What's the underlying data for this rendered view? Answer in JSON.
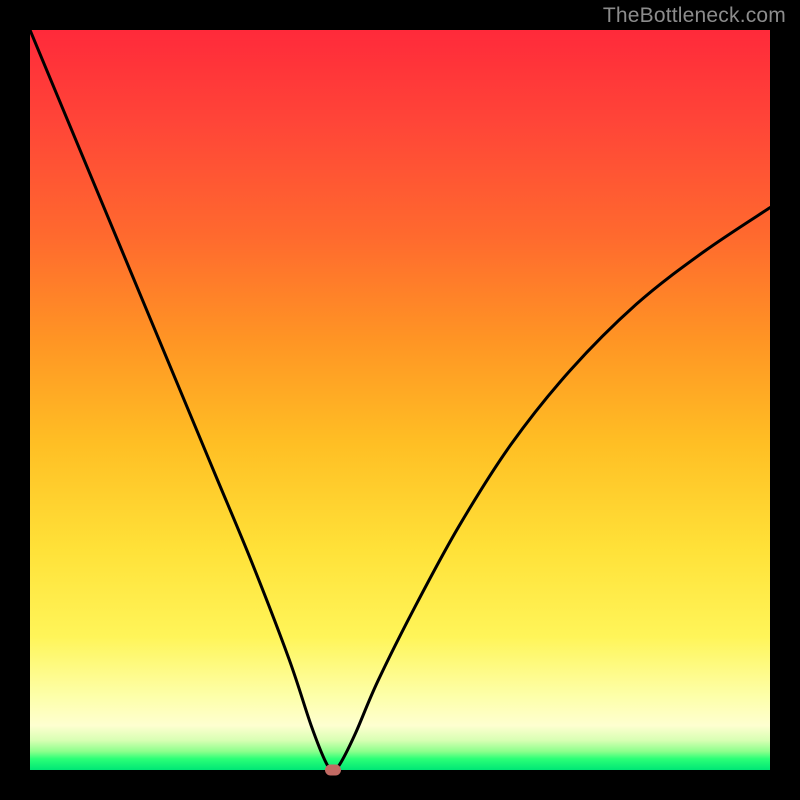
{
  "watermark": {
    "text": "TheBottleneck.com"
  },
  "chart_data": {
    "type": "line",
    "title": "",
    "xlabel": "",
    "ylabel": "",
    "xlim": [
      0,
      100
    ],
    "ylim": [
      0,
      100
    ],
    "grid": false,
    "legend": false,
    "background_gradient": {
      "top": "#ff2a3a",
      "mid_upper": "#ff9524",
      "mid": "#ffe138",
      "lower": "#fdffa9",
      "bottom": "#00e676"
    },
    "series": [
      {
        "name": "bottleneck-curve",
        "color": "#000000",
        "x": [
          0,
          5,
          10,
          15,
          20,
          25,
          30,
          35,
          38,
          40,
          41,
          42,
          44,
          47,
          52,
          58,
          65,
          73,
          82,
          91,
          100
        ],
        "y": [
          100,
          88,
          76,
          64,
          52,
          40,
          28,
          15,
          6,
          1,
          0,
          1,
          5,
          12,
          22,
          33,
          44,
          54,
          63,
          70,
          76
        ]
      }
    ],
    "marker": {
      "name": "optimal-point",
      "x": 41,
      "y": 0,
      "color": "#c26a63"
    }
  }
}
